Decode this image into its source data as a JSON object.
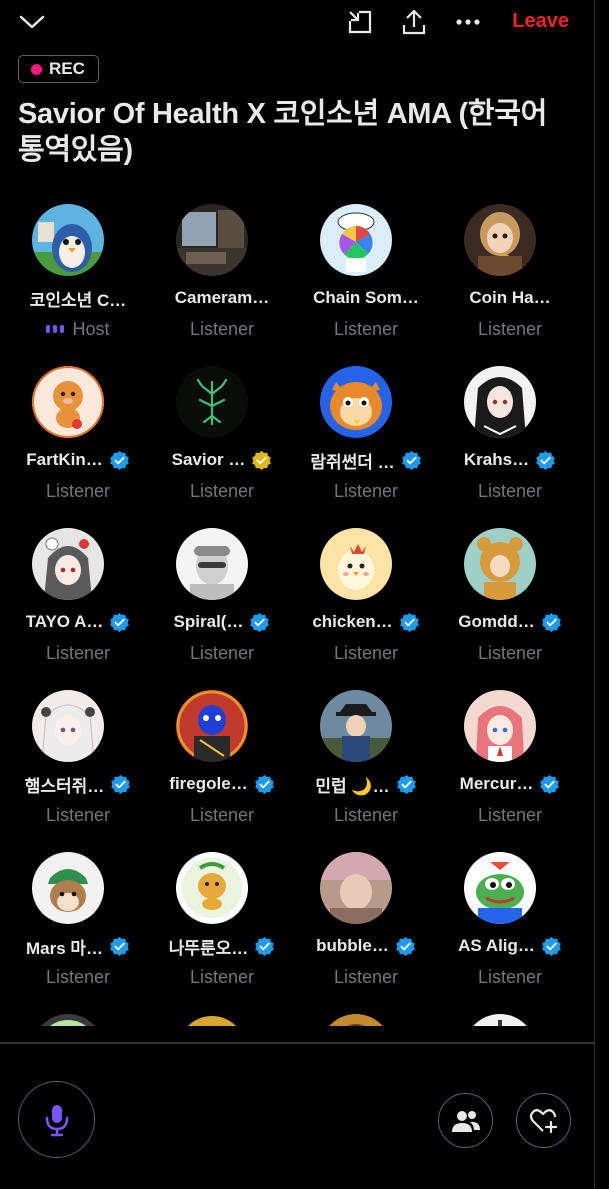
{
  "header": {
    "collapse_icon": "chevron-down-icon",
    "minimize_icon": "minimize-window-icon",
    "share_icon": "share-upload-icon",
    "more_icon": "more-dots-icon",
    "leave_label": "Leave"
  },
  "recording": {
    "label": "REC",
    "dot_color": "#f91880"
  },
  "space": {
    "title": "Savior Of Health X 코인소년 AMA (한국어 통역있음)"
  },
  "participants": [
    {
      "name": "코인소년 C…",
      "role": "Host",
      "verified": "none"
    },
    {
      "name": "Cameram…",
      "role": "Listener",
      "verified": "none"
    },
    {
      "name": "Chain Som…",
      "role": "Listener",
      "verified": "none"
    },
    {
      "name": "Coin Ha…",
      "role": "Listener",
      "verified": "blue"
    },
    {
      "name": "FartKin…",
      "role": "Listener",
      "verified": "blue"
    },
    {
      "name": "Savior …",
      "role": "Listener",
      "verified": "gold"
    },
    {
      "name": "람쥐썬더 …",
      "role": "Listener",
      "verified": "blue"
    },
    {
      "name": "Krahs…",
      "role": "Listener",
      "verified": "blue"
    },
    {
      "name": "TAYO A…",
      "role": "Listener",
      "verified": "blue"
    },
    {
      "name": "Spiral(…",
      "role": "Listener",
      "verified": "blue"
    },
    {
      "name": "chicken…",
      "role": "Listener",
      "verified": "blue"
    },
    {
      "name": "Gomdd…",
      "role": "Listener",
      "verified": "blue"
    },
    {
      "name": "햄스터쥐…",
      "role": "Listener",
      "verified": "blue"
    },
    {
      "name": "firegole…",
      "role": "Listener",
      "verified": "blue"
    },
    {
      "name": "민럽 🌙…",
      "role": "Listener",
      "verified": "blue"
    },
    {
      "name": "Mercur…",
      "role": "Listener",
      "verified": "blue"
    },
    {
      "name": "Mars 마…",
      "role": "Listener",
      "verified": "blue"
    },
    {
      "name": "나뚜룬오…",
      "role": "Listener",
      "verified": "blue"
    },
    {
      "name": "bubble…",
      "role": "Listener",
      "verified": "blue"
    },
    {
      "name": "AS Alig…",
      "role": "Listener",
      "verified": "blue"
    }
  ],
  "footer": {
    "mic_icon": "microphone-icon",
    "people_icon": "people-icon",
    "heart_icon": "heart-add-icon"
  },
  "colors": {
    "accent_blue": "#1d9bf0",
    "gold": "#e2b719",
    "leave_red": "#f4212e",
    "host_purple": "#7856ff",
    "muted_text": "#71767b"
  }
}
